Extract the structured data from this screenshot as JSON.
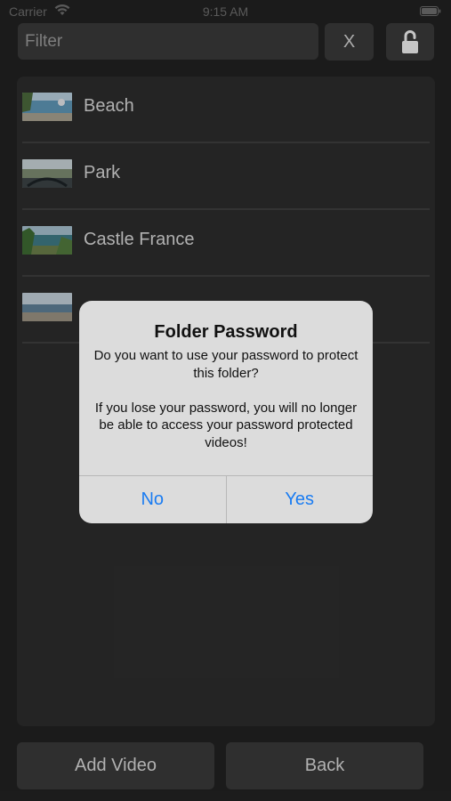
{
  "status_bar": {
    "carrier": "Carrier",
    "time": "9:15 AM",
    "wifi_icon": "wifi-icon",
    "battery_icon": "battery-icon"
  },
  "toolbar": {
    "filter_placeholder": "Filter",
    "filter_value": "",
    "clear_label": "X",
    "lock_icon": "unlocked-lock-icon"
  },
  "videos": [
    {
      "label": "Beach"
    },
    {
      "label": "Park"
    },
    {
      "label": "Castle France"
    },
    {
      "label": ""
    }
  ],
  "alert": {
    "title": "Folder Password",
    "message_1": "Do you want to use your password to protect this folder?",
    "message_2": "If you lose your password, you will no longer be able to access your password protected videos!",
    "no_label": "No",
    "yes_label": "Yes",
    "button_color": "#1a7cf2"
  },
  "bottom_bar": {
    "add_video_label": "Add Video",
    "back_label": "Back"
  }
}
